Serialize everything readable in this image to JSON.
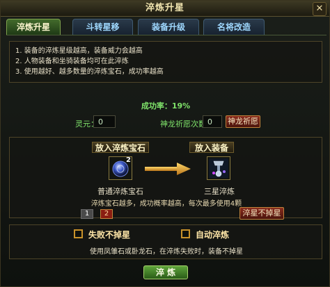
{
  "window": {
    "title": "淬炼升星"
  },
  "tabs": [
    {
      "label": "淬炼升星"
    },
    {
      "label": "斗转星移"
    },
    {
      "label": "装备升级"
    },
    {
      "label": "名将改造"
    }
  ],
  "rules": [
    "1. 装备的淬炼星级越高，装备威力会越高",
    "2. 人物装备和坐骑装备均可在此淬炼",
    "3. 使用越好、越多数量的淬炼宝石，成功率越高"
  ],
  "success": {
    "text": "成功率：19%"
  },
  "spirit": {
    "label": "灵元：",
    "value": "0"
  },
  "prayer": {
    "label": "神龙祈愿次数：",
    "value": "0",
    "button": "神龙祈愿"
  },
  "gem": {
    "header": "放入淬炼宝石",
    "name": "普通淬炼宝石",
    "count": "2",
    "icon": "gem-icon"
  },
  "equip": {
    "header": "放入装备",
    "name": "三星淬炼",
    "icon": "equipment-icon"
  },
  "hint": "淬炼宝石越多，成功概率越高，每次最多使用4颗",
  "pages": [
    "1",
    "2"
  ],
  "star_nodrop_button": "淬星不掉星",
  "options": {
    "no_drop_label": "失败不掉星",
    "auto_label": "自动淬炼",
    "note": "使用凤雏石或卧龙石，在淬炼失败时，装备不掉星"
  },
  "action_button": "淬 炼",
  "colors": {
    "accent_green": "#7fe36a",
    "button_red": "#8a2d1e",
    "border_gold": "#c9922a"
  }
}
